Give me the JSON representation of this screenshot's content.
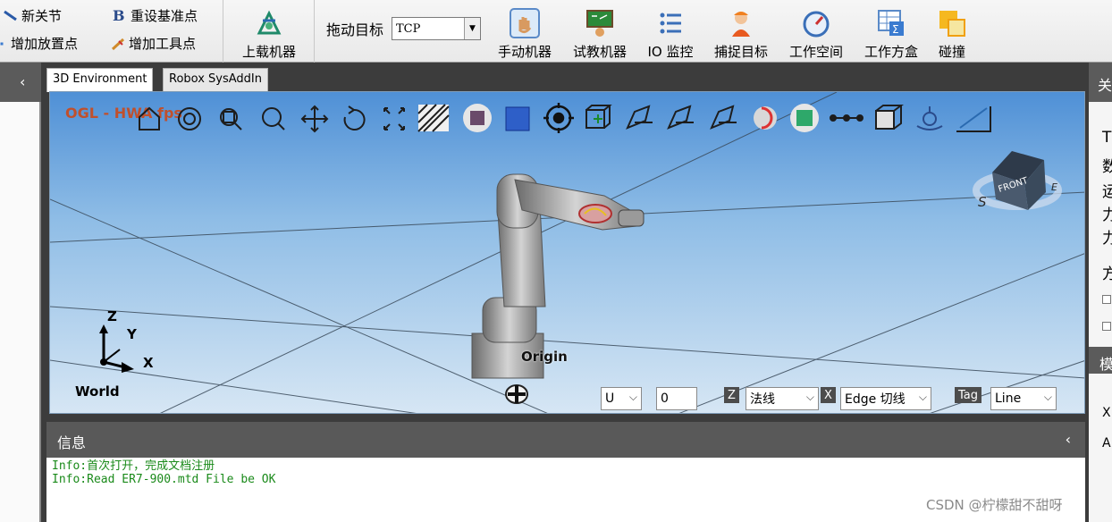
{
  "toolbar": {
    "new_joint": "新关节",
    "reset_base": "重设基准点",
    "add_place_point": "增加放置点",
    "add_tool_point": "增加工具点",
    "load_machine": "上载机器",
    "drag_target_label": "拖动目标",
    "drag_target_value": "TCP",
    "manual_machine": "手动机器",
    "teach_machine": "试教机器",
    "io_monitor": "IO 监控",
    "capture_target": "捕捉目标",
    "workspace": "工作空间",
    "work_box": "工作方盒",
    "collision": "碰撞"
  },
  "left_pane": {
    "chevron": "‹"
  },
  "tabs": [
    {
      "label": "3D Environment",
      "active": true
    },
    {
      "label": "Robox SysAddIn",
      "active": false
    }
  ],
  "viewport": {
    "renderer_label": "OGL - HWA fps",
    "world_label": "World",
    "axis_z": "Z",
    "axis_y": "Y",
    "axis_x": "X",
    "origin_label": "Origin",
    "cube_front": "FRONT",
    "compass_s": "S",
    "compass_e": "E",
    "u_select": "U",
    "u_value": "0",
    "z_badge": "Z",
    "normal_select": "法线",
    "x_badge": "X",
    "edge_select": "Edge 切线",
    "tag_badge": "Tag",
    "line_select": "Line"
  },
  "info_panel": {
    "title": "信息",
    "chevron": "‹",
    "messages": [
      "Info:首次打开，完成文档注册",
      "Info:Read ER7-900.mtd File be OK"
    ]
  },
  "right_pane": {
    "header_char": "关",
    "chars": [
      "T",
      "数",
      "运",
      "力",
      "力",
      "方",
      "模",
      "X",
      "A"
    ]
  },
  "watermark": "CSDN @柠檬甜不甜呀",
  "colors": {
    "viewport_top": "#4f90d6",
    "info_text": "#1a8a1a",
    "renderer_label": "#c0502c"
  }
}
